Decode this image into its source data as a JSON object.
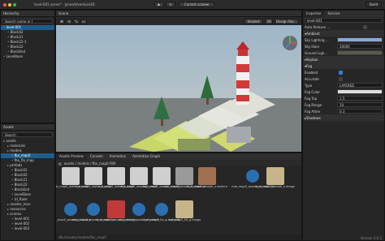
{
  "titlebar": {
    "title": "level-001.scene* - JanesAdventure3D",
    "scene_switch": "Current scene",
    "build": "Build"
  },
  "hierarchy": {
    "title": "Hierarchy",
    "search": "Search name or l",
    "items": [
      {
        "label": "level-001",
        "depth": 0,
        "selected": true
      },
      {
        "label": "Block02",
        "depth": 1,
        "selected": false
      },
      {
        "label": "Block21",
        "depth": 1,
        "selected": false
      },
      {
        "label": "Block22-1",
        "depth": 1,
        "selected": false
      },
      {
        "label": "Block22",
        "depth": 1,
        "selected": false
      },
      {
        "label": "BlockEnd",
        "depth": 1,
        "selected": false
      },
      {
        "label": "LevelBase",
        "depth": 0,
        "selected": false
      }
    ]
  },
  "assets": {
    "title": "Assets",
    "search": "Search",
    "items": [
      {
        "label": "assets",
        "depth": 0
      },
      {
        "label": "materials",
        "depth": 1
      },
      {
        "label": "models",
        "depth": 1
      },
      {
        "label": "fbx_map0",
        "depth": 2,
        "selected": true
      },
      {
        "label": "fbx_flo_map",
        "depth": 2
      },
      {
        "label": "prefabs",
        "depth": 1
      },
      {
        "label": "Block01",
        "depth": 2
      },
      {
        "label": "Block02",
        "depth": 2
      },
      {
        "label": "Block21",
        "depth": 2
      },
      {
        "label": "Block22",
        "depth": 2
      },
      {
        "label": "BlockEnd",
        "depth": 2
      },
      {
        "label": "LevelBase",
        "depth": 2
      },
      {
        "label": "UI_Rank",
        "depth": 2
      },
      {
        "label": "rooster_man",
        "depth": 1
      },
      {
        "label": "resources",
        "depth": 1
      },
      {
        "label": "scenes",
        "depth": 1
      },
      {
        "label": "level-001",
        "depth": 2
      },
      {
        "label": "level-002",
        "depth": 2
      },
      {
        "label": "level-003",
        "depth": 2
      }
    ]
  },
  "scene": {
    "title": "Scene",
    "shading": "Shaded",
    "camera": "Design Res..."
  },
  "bottom": {
    "tabs": [
      "Assets Preview",
      "Console",
      "Animation",
      "Animation Graph"
    ],
    "path": "assets / models / fbx_map0.FBX",
    "tiles": [
      {
        "name": "mat_map0_water_s.mesh",
        "kind": "mesh"
      },
      {
        "name": "mat_map0_water_s.mesh",
        "kind": "mesh"
      },
      {
        "name": "mat_map0_water_s.mesh",
        "kind": "mesh"
      },
      {
        "name": "mat_map0_woode_n.mesh",
        "kind": "mesh"
      },
      {
        "name": "mat_map0_woode_n.mesh",
        "kind": "mesh"
      },
      {
        "name": "mat_map0_woode_n.material",
        "kind": "material"
      },
      {
        "name": "mat_map0_woode_n.texture",
        "kind": "texture"
      },
      {
        "name": "",
        "kind": "blank"
      },
      {
        "name": "mat_map0_woode_n.material",
        "kind": "material-blue"
      },
      {
        "name": "mat_map0_woode_n.image",
        "kind": "image"
      },
      {
        "name": "mat_map0_woode_n.texture",
        "kind": "texture-blue"
      },
      {
        "name": "mat_map0_woode_n.material",
        "kind": "material-blue"
      },
      {
        "name": "mat_map0_woode_n.image",
        "kind": "image-red"
      },
      {
        "name": "mat_map0_woode_n.texture",
        "kind": "texture-blue"
      },
      {
        "name": "mat_map0_fla_g.material",
        "kind": "material-blue"
      },
      {
        "name": "mat_map0_fla_g.image",
        "kind": "image"
      }
    ],
    "status": "db://assets/models/fbx_map0",
    "version": "Version 3.6.3"
  },
  "inspector": {
    "tab1": "Inspector",
    "tab2": "Service",
    "node": "level-001",
    "auto_release": "Auto Release ...",
    "ambient": {
      "title": "Ambient",
      "rows": [
        {
          "label": "Sky Lighting ...",
          "value": "",
          "swatch": "#8aa8d8"
        },
        {
          "label": "Sky Illum",
          "value": "20000"
        },
        {
          "label": "Ground Ligh...",
          "value": "",
          "swatch": "#5a5a4a"
        }
      ]
    },
    "skybox": {
      "title": "Skybox",
      "rows": [
        {
          "label": "Enabled",
          "check": true
        },
        {
          "label": "Env Lighting ...",
          "value": "HEMISPHERE_DIFFUSE"
        },
        {
          "label": "Use HDR",
          "check": true
        },
        {
          "label": "Envmap",
          "value": "default_skybox"
        },
        {
          "label": "Reflection Co...",
          "value": "Bake"
        },
        {
          "label": "Rotation Angle",
          "value": "0"
        },
        {
          "label": "Skybox Mater...",
          "value": "default"
        }
      ]
    },
    "fog": {
      "title": "Fog",
      "rows": [
        {
          "label": "Enabled",
          "check": true
        },
        {
          "label": "Accurate",
          "check": false
        },
        {
          "label": "Type",
          "value": "LAYERED"
        },
        {
          "label": "Fog Color",
          "value": "",
          "swatch": "#dddddd"
        },
        {
          "label": "Fog Top",
          "value": "1.5"
        },
        {
          "label": "Fog Range",
          "value": "10"
        },
        {
          "label": "Fog Atten",
          "value": "0.3"
        }
      ]
    },
    "shadows": "Shadows"
  }
}
